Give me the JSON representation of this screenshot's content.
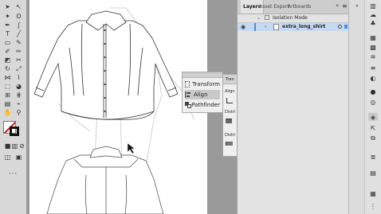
{
  "layers_panel": {
    "tabs": [
      {
        "label": "Layers",
        "active": true
      },
      {
        "label": "Asset Export",
        "active": false
      },
      {
        "label": "Artboards",
        "active": false
      }
    ],
    "menu_glyph": "≡",
    "collapse_glyph": "«",
    "isolation_row": {
      "label": "Isolation Mode"
    },
    "layer_row": {
      "label": "extra_long_shirt",
      "selected": true
    }
  },
  "floating_panel": {
    "items": [
      {
        "label": "Transform",
        "icon": "transform-icon",
        "active": false
      },
      {
        "label": "Align",
        "icon": "align-icon",
        "active": true
      },
      {
        "label": "Pathfinder",
        "icon": "pathfinder-icon",
        "active": false
      }
    ]
  },
  "align_panel": {
    "tab_label": "Tran",
    "align_label": "Align",
    "distribute_label_1": "Distri",
    "distribute_label_2": "Distri"
  },
  "colors": {
    "selection_blue": "#c5d9f3",
    "layer_color": "#4f8fd6",
    "canvas_gray": "#9a9a9a",
    "ui_gray": "#e3e3e3"
  },
  "tools_icons": [
    "selection-icon",
    "direct-selection-icon",
    "magic-wand-icon",
    "lasso-icon",
    "pen-icon",
    "curvature-icon",
    "type-icon",
    "line-icon",
    "rectangle-icon",
    "brush-icon",
    "shaper-icon",
    "pencil-icon",
    "eraser-icon",
    "scissors-icon",
    "rotate-icon",
    "scale-icon",
    "width-icon",
    "warp-icon",
    "free-transform-icon",
    "shape-builder-icon",
    "perspective-icon",
    "mesh-icon",
    "gradient-icon",
    "eyedropper-icon",
    "blend-icon",
    "symbol-sprayer-icon",
    "graph-icon",
    "artboard-icon",
    "slice-icon",
    "hand-icon",
    "zoom-icon"
  ]
}
